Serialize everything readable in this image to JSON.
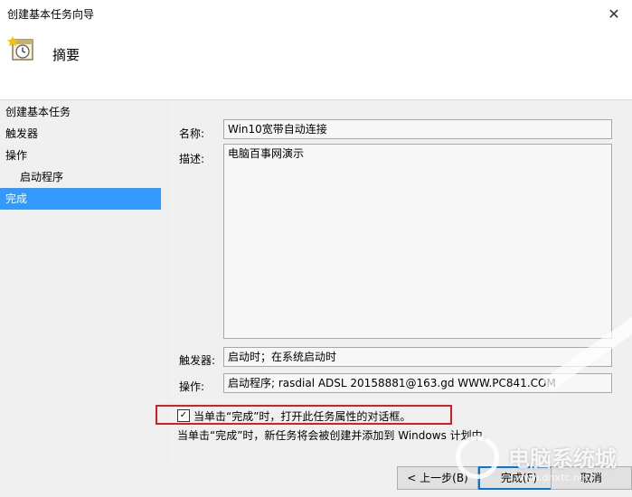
{
  "window": {
    "title": "创建基本任务向导"
  },
  "header": {
    "title": "摘要",
    "icon": "calendar-clock-icon"
  },
  "steps": [
    {
      "label": "创建基本任务"
    },
    {
      "label": "触发器"
    },
    {
      "label": "操作"
    },
    {
      "label": "启动程序"
    },
    {
      "label": "完成",
      "active": true
    }
  ],
  "form": {
    "name_label": "名称:",
    "name_value": "Win10宽带自动连接",
    "desc_label": "描述:",
    "desc_value": "电脑百事网演示",
    "trigger_label": "触发器:",
    "trigger_value": "启动时；在系统启动时",
    "action_label": "操作:",
    "action_value": "启动程序; rasdial ADSL 20158881@163.gd WWW.PC841.COM"
  },
  "checkbox": {
    "label": "当单击“完成”时，打开此任务属性的对话框。",
    "checked": true
  },
  "note": "当单击“完成”时，新任务将会被创建并添加到 Windows 计划中。",
  "buttons": {
    "back": "< 上一步(B)",
    "finish": "完成(F)",
    "cancel": "取消"
  },
  "watermark": {
    "text": "电脑系统城",
    "sub": "www.dnxtc.net"
  },
  "colors": {
    "accent": "#3399ff",
    "highlight_border": "#d32020",
    "focus": "#0078d7"
  }
}
